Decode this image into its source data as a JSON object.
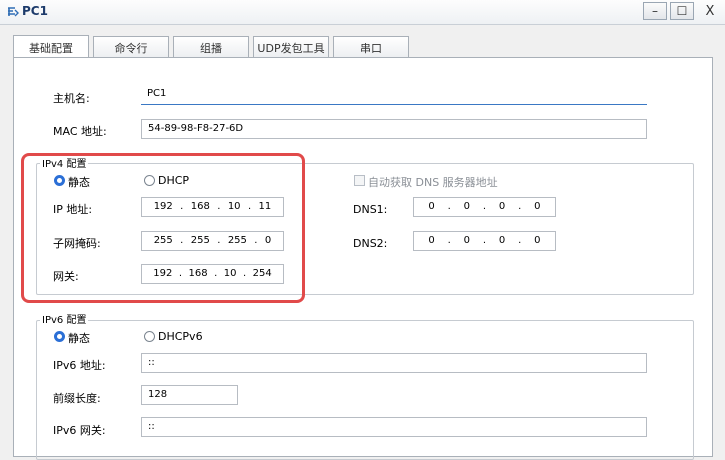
{
  "window": {
    "title": "PC1",
    "minimize_glyph": "–",
    "maximize_glyph": "☐",
    "close_glyph": "X"
  },
  "tabs": [
    {
      "label": "基础配置",
      "active": true
    },
    {
      "label": "命令行"
    },
    {
      "label": "组播"
    },
    {
      "label": "UDP发包工具"
    },
    {
      "label": "串口"
    }
  ],
  "basic": {
    "hostname_label": "主机名:",
    "hostname_value": "PC1",
    "mac_label": "MAC 地址:",
    "mac_value": "54-89-98-F8-27-6D"
  },
  "ipv4": {
    "group_title": "IPv4 配置",
    "static_label": "静态",
    "dhcp_label": "DHCP",
    "auto_dns_label": "自动获取 DNS 服务器地址",
    "ip_label": "IP 地址:",
    "ip": [
      "192",
      "168",
      "10",
      "11"
    ],
    "mask_label": "子网掩码:",
    "mask": [
      "255",
      "255",
      "255",
      "0"
    ],
    "gateway_label": "网关:",
    "gateway": [
      "192",
      "168",
      "10",
      "254"
    ],
    "dns1_label": "DNS1:",
    "dns1": [
      "0",
      "0",
      "0",
      "0"
    ],
    "dns2_label": "DNS2:",
    "dns2": [
      "0",
      "0",
      "0",
      "0"
    ]
  },
  "ipv6": {
    "group_title": "IPv6 配置",
    "static_label": "静态",
    "dhcp_label": "DHCPv6",
    "ip_label": "IPv6 地址:",
    "ip_value": "::",
    "prefix_label": "前缀长度:",
    "prefix_value": "128",
    "gateway_label": "IPv6 网关:",
    "gateway_value": "::"
  },
  "ip_separator": "."
}
